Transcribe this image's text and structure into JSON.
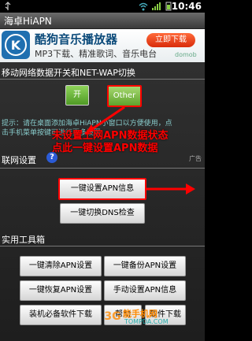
{
  "status": {
    "time": "10:46",
    "icons": [
      "usb-icon",
      "wifi-signal-icon",
      "cellular-signal-icon",
      "battery-icon"
    ]
  },
  "app": {
    "title": "海卓HiAPN"
  },
  "ad": {
    "title": "酷狗音乐播放器",
    "subtitle": "MP3下载、精准歌词、音乐电台",
    "button": "立即下载",
    "brand": "domob"
  },
  "mobile_data": {
    "title": "移动网络数据开关和NET-WAP切换",
    "toggle_on": "开",
    "toggle_other": "Other"
  },
  "hint": {
    "line1": "提示：请在桌面添加海卓HiAPN小窗口以方便使用，点",
    "line2": "击手机菜单按键可进行更多设置"
  },
  "annotation": {
    "line1": "未设置上网APN数据状态",
    "line2": "点此一键设置APN数据"
  },
  "network": {
    "title": "联网设置",
    "ad_suffix": "广告",
    "btn_set_apn": "一键设置APN信息",
    "btn_dns": "一键切换DNS检查"
  },
  "tools": {
    "title": "实用工具箱",
    "btn_clear_apn": "一键清除APN设置",
    "btn_backup_apn": "一键备份APN设置",
    "btn_restore_apn": "一键恢复APN设置",
    "btn_manual_apn": "手动设置APN信息",
    "btn_software": "装机必备软件下载",
    "btn_help": "帮助",
    "btn_other": "软件下载"
  },
  "watermark": {
    "text": "能手机网",
    "url": "TOMPDA.COM"
  },
  "colors": {
    "annotation": "#ff0000",
    "toggle_green": "#5ea22c"
  }
}
